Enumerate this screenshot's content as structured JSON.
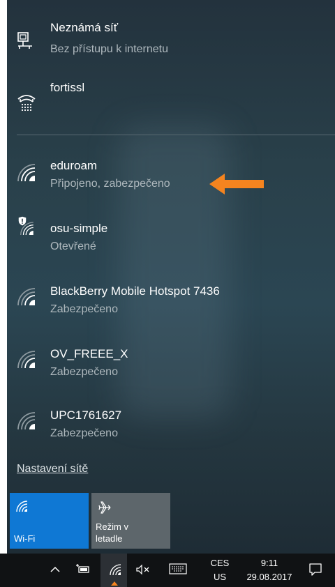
{
  "networks": [
    {
      "name": "Neznámá síť",
      "status": "Bez přístupu k internetu",
      "icon": "ethernet-icon"
    },
    {
      "name": "fortissl",
      "status": "",
      "icon": "dialup-icon"
    },
    {
      "name": "eduroam",
      "status": "Připojeno, zabezpečeno",
      "icon": "wifi-icon"
    },
    {
      "name": "osu-simple",
      "status": "Otevřené",
      "icon": "wifi-open-shield-icon"
    },
    {
      "name": "BlackBerry Mobile Hotspot 7436",
      "status": "Zabezpečeno",
      "icon": "wifi-icon"
    },
    {
      "name": "OV_FREEE_X",
      "status": "Zabezpečeno",
      "icon": "wifi-icon"
    },
    {
      "name": "UPC1761627",
      "status": "Zabezpečeno",
      "icon": "wifi-icon"
    }
  ],
  "settings_link": "Nastavení sítě",
  "tiles": {
    "wifi": {
      "label": "Wi-Fi",
      "active": true
    },
    "airplane": {
      "label_line1": "Režim v",
      "label_line2": "letadle",
      "active": false
    }
  },
  "taskbar": {
    "lang_top": "CES",
    "lang_bottom": "US",
    "time": "9:11",
    "date": "29.08.2017"
  },
  "colors": {
    "accent": "#0f78d4",
    "annotation_arrow": "#f5841f"
  }
}
